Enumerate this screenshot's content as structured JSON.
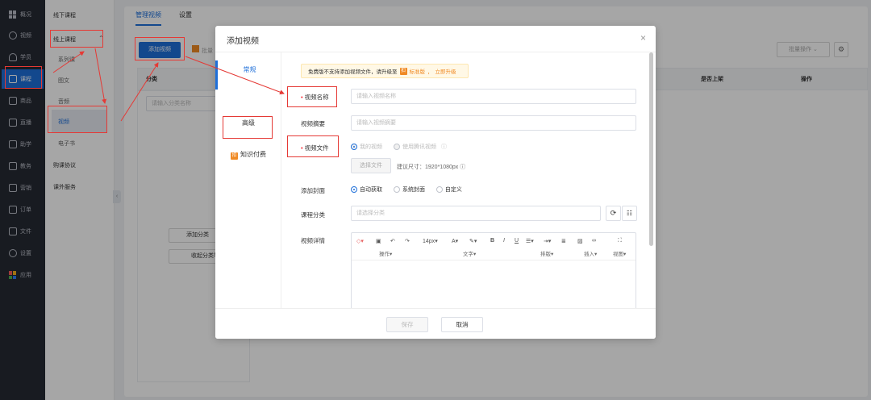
{
  "sidebar": {
    "items": [
      {
        "label": "概况",
        "icon": "grid-icon"
      },
      {
        "label": "视频",
        "icon": "video-icon"
      },
      {
        "label": "学员",
        "icon": "user-icon"
      },
      {
        "label": "课程",
        "icon": "course-icon",
        "active": true
      },
      {
        "label": "商品",
        "icon": "goods-icon"
      },
      {
        "label": "直播",
        "icon": "live-icon"
      },
      {
        "label": "助学",
        "icon": "study-icon"
      },
      {
        "label": "教务",
        "icon": "academic-icon"
      },
      {
        "label": "营销",
        "icon": "marketing-icon"
      },
      {
        "label": "订单",
        "icon": "order-icon"
      },
      {
        "label": "文件",
        "icon": "folder-icon"
      },
      {
        "label": "设置",
        "icon": "settings-icon"
      },
      {
        "label": "应用",
        "icon": "apps-icon"
      }
    ]
  },
  "subnav": {
    "offline": "线下课程",
    "online": "线上课程",
    "expand_icon": "chevron-up-icon",
    "children": [
      "系列课",
      "图文",
      "音频",
      "视频",
      "电子书"
    ],
    "active_child": "视频",
    "agreement": "购课协议",
    "extra": "课外服务"
  },
  "main": {
    "tabs": [
      "管理视频",
      "设置"
    ],
    "add_video_button": "添加视频",
    "batch_partial": "批量",
    "batch_button": "批量操作",
    "category_header": "分类",
    "category_placeholder": "请输入分类名称",
    "col_on_shelf": "是否上架",
    "col_actions": "操作",
    "add_category_button": "添加分类",
    "collapse_category_button": "收起分类导航"
  },
  "modal": {
    "title": "添加视频",
    "close_icon": "close-icon",
    "tabs": {
      "general": "常规",
      "advanced": "高级",
      "paid": "知识付费"
    },
    "paid_badge": "扣",
    "notice": {
      "text": "免费版不支持添加视频文件，请升级至",
      "badge": "扣",
      "edition": "标准版",
      "link": "立即升级"
    },
    "fields": {
      "name_label": "视频名称",
      "name_placeholder": "请输入视频名称",
      "summary_label": "视频摘要",
      "summary_placeholder": "请输入视频摘要",
      "file_label": "视频文件",
      "file_opt_mine": "我的视频",
      "file_opt_tencent": "使用腾讯视频",
      "select_file_button": "选择文件",
      "size_hint": "建议尺寸：1920*1080px",
      "cover_label": "添加封面",
      "cover_options": [
        "自动获取",
        "系统封面",
        "自定义"
      ],
      "category_label": "课程分类",
      "category_placeholder": "请选择分类",
      "detail_label": "视频详情"
    },
    "toolbar": {
      "font_size": "14px",
      "groups": [
        "操作",
        "文字",
        "排版",
        "插入",
        "视图"
      ]
    },
    "footer": {
      "save": "保存",
      "cancel": "取消"
    }
  },
  "colors": {
    "accent": "#1e6fd9",
    "annotation": "#e53935",
    "sidebar": "#262a33",
    "warning": "#f08a24"
  }
}
